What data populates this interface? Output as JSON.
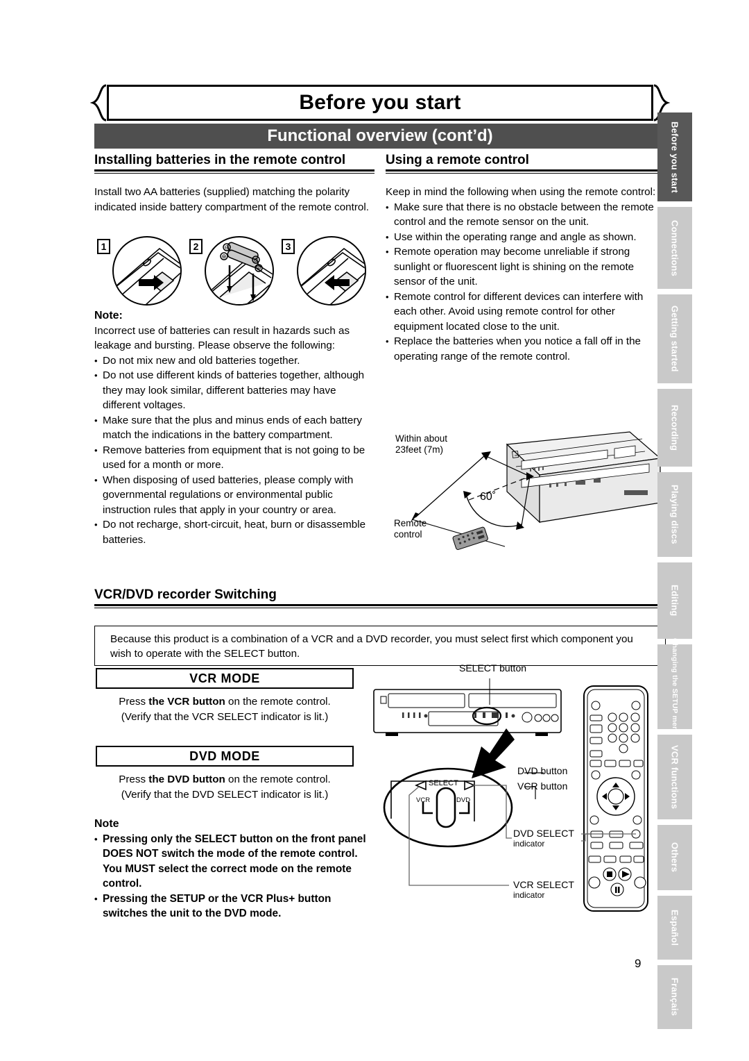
{
  "banner": {
    "title": "Before you start"
  },
  "section_bar": {
    "title": "Functional overview (cont’d)"
  },
  "headings": {
    "batteries": "Installing batteries in the remote control",
    "using_remote": "Using a remote control",
    "switching": "VCR/DVD recorder Switching"
  },
  "batteries": {
    "intro": "Install two AA batteries (supplied) matching the polarity indicated inside battery compartment of the remote control.",
    "steps": [
      {
        "number": "1",
        "caption": "open-battery-cover"
      },
      {
        "number": "2",
        "caption": "insert-aa-batteries"
      },
      {
        "number": "3",
        "caption": "close-battery-cover"
      }
    ],
    "battery_polarity": {
      "plus": "⊕",
      "minus": "⊖"
    },
    "note_title": "Note:",
    "note_intro": "Incorrect use of batteries can result in hazards such as leakage and bursting. Please observe the following:",
    "note_bullets": [
      "Do not mix new and old batteries together.",
      "Do not use different kinds of batteries together, although they may look similar, different batteries may have different voltages.",
      "Make sure that the plus and minus ends of each battery match the indications in the battery compartment.",
      "Remove batteries from equipment that is not going to be used for a month or more.",
      "When disposing of used batteries, please comply with governmental regulations or environmental public instruction rules that apply in your country or area.",
      "Do not recharge, short-circuit, heat, burn or disassemble batteries."
    ]
  },
  "using_remote": {
    "intro": "Keep in mind the following when using the remote control:",
    "bullets": [
      "Make sure that there is no obstacle between the remote control and the remote sensor on the unit.",
      "Use within the operating range and angle as shown.",
      "Remote operation may become unreliable if strong sunlight or fluorescent light is shining on the remote sensor of the unit.",
      "Remote control for different devices can interfere with each other.  Avoid using remote control for other equipment located close to the unit.",
      "Replace the batteries when you notice a fall off in the operating range of the remote control."
    ],
    "diagram": {
      "distance_label_line1": "Within about",
      "distance_label_line2": "23feet (7m)",
      "angle_label": "60˚",
      "remote_label_line1": "Remote",
      "remote_label_line2": "control"
    }
  },
  "switching": {
    "intro_box": "Because this product is a combination of a VCR and a DVD recorder, you must select first which component you wish to operate with the SELECT button.",
    "vcr_mode_title": "VCR MODE",
    "vcr_mode_line1_a": "Press ",
    "vcr_mode_line1_b": "the VCR button",
    "vcr_mode_line1_c": " on the remote control.",
    "vcr_mode_line2": "(Verify that the VCR SELECT indicator is lit.)",
    "dvd_mode_title": "DVD MODE",
    "dvd_mode_line1_a": "Press ",
    "dvd_mode_line1_b": "the DVD button",
    "dvd_mode_line1_c": " on the remote control.",
    "dvd_mode_line2": "(Verify that the DVD SELECT indicator is lit.)",
    "note_title": "Note",
    "note_bullets": [
      "Pressing only the SELECT button on the front panel DOES NOT switch the mode of the remote control. You MUST select the correct mode on the remote control.",
      "Pressing the SETUP or the VCR Plus+ button switches the unit to the DVD mode."
    ],
    "diagram": {
      "select_button_label": "SELECT button",
      "select_caption": "SELECT",
      "vcr_small": "VCR",
      "dvd_small": "DVD",
      "dvd_button_label": "DVD button",
      "vcr_button_label": "VCR button",
      "dvd_select_line1": "DVD SELECT",
      "dvd_select_line2": "indicator",
      "vcr_select_line1": "VCR SELECT",
      "vcr_select_line2": "indicator"
    }
  },
  "tabs": [
    {
      "label": "Before you start",
      "active": true
    },
    {
      "label": "Connections",
      "active": false
    },
    {
      "label": "Getting started",
      "active": false
    },
    {
      "label": "Recording",
      "active": false
    },
    {
      "label": "Playing discs",
      "active": false
    },
    {
      "label": "Editing",
      "active": false
    },
    {
      "label": "Changing the SETUP menu",
      "active": false
    },
    {
      "label": "VCR functions",
      "active": false
    },
    {
      "label": "Others",
      "active": false
    },
    {
      "label": "Español",
      "active": false
    },
    {
      "label": "Français",
      "active": false
    }
  ],
  "page_number": "9",
  "colors": {
    "bar_dark": "#4f4f4f",
    "tab_inactive": "#c9c9c9",
    "tab_active": "#585858",
    "text": "#000000"
  }
}
